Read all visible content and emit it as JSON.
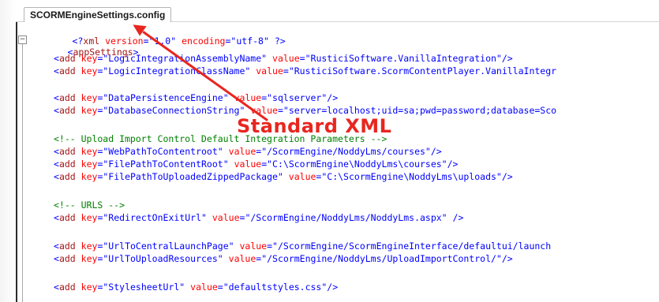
{
  "tab": {
    "title": "SCORMEngineSettings.config"
  },
  "fold_symbol": "⊟",
  "annotation": {
    "text": "Standard XML",
    "color": "#e8261f"
  },
  "colors": {
    "bracket": "#0000ff",
    "tag": "#a31515",
    "attribute": "#ff0000",
    "value": "#0000ff",
    "comment": "#008000"
  },
  "code": {
    "decl": {
      "open": "<?",
      "tag": "xml",
      "a1": "version",
      "v1": "\"1.0\"",
      "a2": "encoding",
      "v2": "\"utf-8\"",
      "close": "?>"
    },
    "root": {
      "open": "<",
      "tag": "appSettings",
      "close": ">"
    },
    "lines": [
      {
        "key": "\"LogicIntegrationAssemblyName\"",
        "value": "\"RusticiSoftware.VanillaIntegration\"",
        "end": "/>"
      },
      {
        "key": "\"LogicIntegrationClassName\"",
        "value": "\"RusticiSoftware.ScormContentPlayer.VanillaIntegr",
        "end": ""
      },
      {
        "key": "\"DataPersistenceEngine\"",
        "value": "\"sqlserver\"",
        "end": "/>"
      },
      {
        "key": "\"DatabaseConnectionString\"",
        "value": "\"server=localhost;uid=sa;pwd=password;database=Sco",
        "end": ""
      },
      {
        "comment": "<!-- Upload Import Control Default Integration Parameters -->"
      },
      {
        "key": "\"WebPathToContentroot\"",
        "value": "\"/ScormEngine/NoddyLms/courses\"",
        "end": "/>"
      },
      {
        "key": "\"FilePathToContentRoot\"",
        "value": "\"C:\\ScormEngine\\NoddyLms\\courses\"",
        "end": "/>"
      },
      {
        "key": "\"FilePathToUploadedZippedPackage\"",
        "value": "\"C:\\ScormEngine\\NoddyLms\\uploads\"",
        "end": "/>"
      },
      {
        "comment": "<!-- URLS -->"
      },
      {
        "key": "\"RedirectOnExitUrl\"",
        "value": "\"/ScormEngine/NoddyLms/NoddyLms.aspx\"",
        "end": " />"
      },
      {
        "key": "\"UrlToCentralLaunchPage\"",
        "value": "\"/ScormEngine/ScormEngineInterface/defaultui/launch",
        "end": ""
      },
      {
        "key": "\"UrlToUploadResources\"",
        "value": "\"/ScormEngine/NoddyLms/UploadImportControl/\"",
        "end": "/>"
      },
      {
        "key": "\"StylesheetUrl\"",
        "value": "\"defaultstyles.css\"",
        "end": "/>"
      }
    ],
    "add_tag": "add",
    "key_attr": "key",
    "value_attr": "value"
  }
}
